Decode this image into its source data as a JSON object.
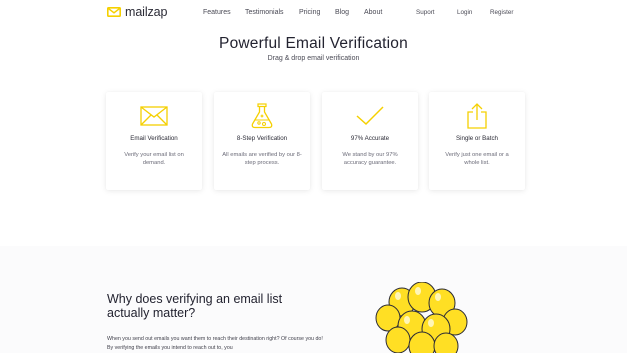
{
  "brand": {
    "name": "mailzap",
    "accent": "#f5d000"
  },
  "nav": {
    "features": "Features",
    "testimonials": "Testimonials",
    "pricing": "Pricing",
    "blog": "Blog",
    "about": "About",
    "support": "Suport",
    "login": "Login",
    "register": "Register"
  },
  "hero": {
    "title": "Powerful Email Verification",
    "subtitle": "Drag & drop email verification"
  },
  "features": [
    {
      "icon": "envelope-icon",
      "title": "Email Verification",
      "desc": "Verify your email list on demand."
    },
    {
      "icon": "flask-icon",
      "title": "8-Step Verification",
      "desc": "All emails are verified by our 8-step process."
    },
    {
      "icon": "checkmark-icon",
      "title": "97% Accurate",
      "desc": "We stand by our 97% accuracy guarantee."
    },
    {
      "icon": "upload-icon",
      "title": "Single or Batch",
      "desc": "Verify just one email or a whole list."
    }
  ],
  "why": {
    "heading": "Why does verifying an email list actually matter?",
    "body": "When you send out emails you want them to reach their destination right? Of course you do! By verifying the emails you intend to reach out to, you"
  }
}
